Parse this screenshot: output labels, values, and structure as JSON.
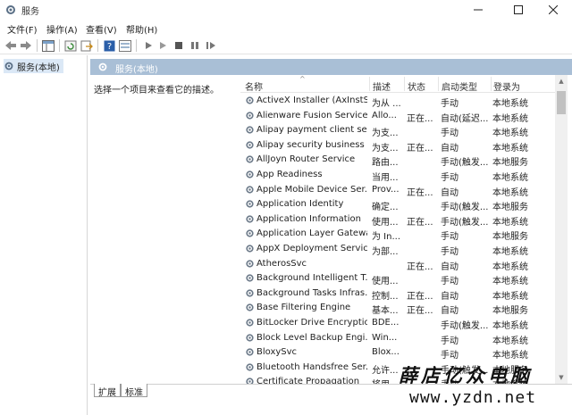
{
  "window": {
    "title": "服务"
  },
  "menu": [
    "文件(F)",
    "操作(A)",
    "查看(V)",
    "帮助(H)"
  ],
  "tree": {
    "root": "服务(本地)"
  },
  "panel": {
    "header": "服务(本地)",
    "hint": "选择一个项目来查看它的描述。"
  },
  "columns": {
    "name": "名称",
    "desc": "描述",
    "status": "状态",
    "startup": "启动类型",
    "logon": "登录为"
  },
  "services": [
    {
      "name": "ActiveX Installer (AxInstSV)",
      "desc": "为从 ...",
      "status": "",
      "startup": "手动",
      "logon": "本地系统"
    },
    {
      "name": "Alienware Fusion Service",
      "desc": "Allo...",
      "status": "正在...",
      "startup": "自动(延迟...",
      "logon": "本地系统"
    },
    {
      "name": "Alipay payment client sec...",
      "desc": "为支...",
      "status": "",
      "startup": "手动",
      "logon": "本地系统"
    },
    {
      "name": "Alipay security business s...",
      "desc": "为支...",
      "status": "正在...",
      "startup": "自动",
      "logon": "本地系统"
    },
    {
      "name": "AllJoyn Router Service",
      "desc": "路由...",
      "status": "",
      "startup": "手动(触发...",
      "logon": "本地服务"
    },
    {
      "name": "App Readiness",
      "desc": "当用...",
      "status": "",
      "startup": "手动",
      "logon": "本地系统"
    },
    {
      "name": "Apple Mobile Device Ser...",
      "desc": "Prov...",
      "status": "正在...",
      "startup": "自动",
      "logon": "本地系统"
    },
    {
      "name": "Application Identity",
      "desc": "确定...",
      "status": "",
      "startup": "手动(触发...",
      "logon": "本地服务"
    },
    {
      "name": "Application Information",
      "desc": "使用...",
      "status": "正在...",
      "startup": "手动(触发...",
      "logon": "本地系统"
    },
    {
      "name": "Application Layer Gatewa...",
      "desc": "为 In...",
      "status": "",
      "startup": "手动",
      "logon": "本地服务"
    },
    {
      "name": "AppX Deployment Servic...",
      "desc": "为部...",
      "status": "",
      "startup": "手动",
      "logon": "本地系统"
    },
    {
      "name": "AtherosSvc",
      "desc": "",
      "status": "正在...",
      "startup": "自动",
      "logon": "本地系统"
    },
    {
      "name": "Background Intelligent T...",
      "desc": "使用...",
      "status": "",
      "startup": "手动",
      "logon": "本地系统"
    },
    {
      "name": "Background Tasks Infras...",
      "desc": "控制...",
      "status": "正在...",
      "startup": "自动",
      "logon": "本地系统"
    },
    {
      "name": "Base Filtering Engine",
      "desc": "基本...",
      "status": "正在...",
      "startup": "自动",
      "logon": "本地服务"
    },
    {
      "name": "BitLocker Drive Encryptio...",
      "desc": "BDE...",
      "status": "",
      "startup": "手动(触发...",
      "logon": "本地系统"
    },
    {
      "name": "Block Level Backup Engi...",
      "desc": "Win...",
      "status": "",
      "startup": "手动",
      "logon": "本地系统"
    },
    {
      "name": "BloxySvc",
      "desc": "Blox...",
      "status": "",
      "startup": "手动",
      "logon": "本地系统"
    },
    {
      "name": "Bluetooth Handsfree Ser...",
      "desc": "允许...",
      "status": "",
      "startup": "手动(触发...",
      "logon": "本地服务"
    },
    {
      "name": "Certificate Propagation",
      "desc": "将用...",
      "status": "",
      "startup": "手动",
      "logon": "本地系统"
    }
  ],
  "tabs": [
    "扩展",
    "标准"
  ],
  "watermark": {
    "line1": "薛店亿众电脑",
    "line2": "www.yzdn.net"
  }
}
